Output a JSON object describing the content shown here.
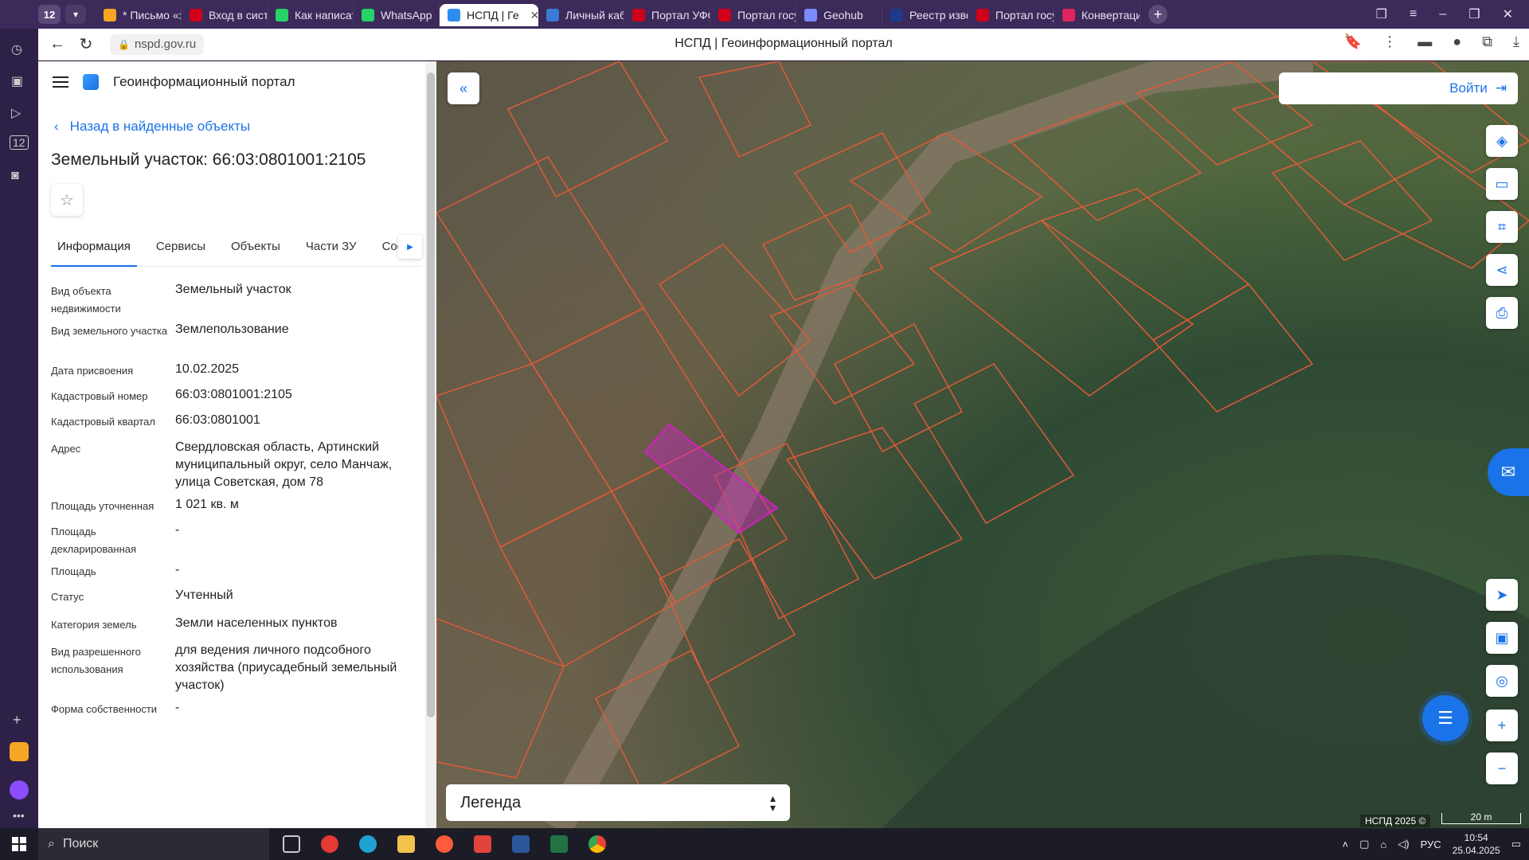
{
  "browser": {
    "tab_count": "12",
    "tabs": [
      {
        "label": "* Письмо «за",
        "color": "#f5a623"
      },
      {
        "label": "Вход в систе",
        "color": "#d0021b"
      },
      {
        "label": "Как написать",
        "color": "#25d366"
      },
      {
        "label": "WhatsApp",
        "color": "#25d366"
      },
      {
        "label": "НСПД | Ге",
        "color": "#2d8cf0"
      },
      {
        "label": "Личный каби",
        "color": "#3a7bd5"
      },
      {
        "label": "Портал УФО",
        "color": "#d0021b"
      },
      {
        "label": "Портал госу",
        "color": "#d0021b"
      },
      {
        "label": "Geohub",
        "color": "#7b8cff"
      },
      {
        "label": "Реестр извец",
        "color": "#1e3a8a"
      },
      {
        "label": "Портал госу",
        "color": "#d0021b"
      },
      {
        "label": "Конвертация",
        "color": "#e0245e"
      }
    ],
    "url": "nspd.gov.ru",
    "page_title": "НСПД | Геоинформационный портал"
  },
  "panel": {
    "portal_name": "Геоинформационный портал",
    "back_label": "Назад в найденные объекты",
    "title": "Земельный участок: 66:03:0801001:2105",
    "tabs": [
      "Информация",
      "Сервисы",
      "Объекты",
      "Части ЗУ",
      "Соста"
    ],
    "fields": [
      {
        "label": "Вид объекта недвижимости",
        "value": "Земельный участок"
      },
      {
        "label": "Вид земельного участка",
        "value": "Землепользование"
      },
      {
        "label": "Дата присвоения",
        "value": "10.02.2025"
      },
      {
        "label": "Кадастровый номер",
        "value": "66:03:0801001:2105"
      },
      {
        "label": "Кадастровый квартал",
        "value": "66:03:0801001"
      },
      {
        "label": "Адрес",
        "value": "Свердловская область, Артинский муниципальный округ, село Манчаж, улица Советская, дом 78"
      },
      {
        "label": "Площадь уточненная",
        "value": "1 021 кв. м"
      },
      {
        "label": "Площадь декларированная",
        "value": "-"
      },
      {
        "label": "Площадь",
        "value": "-"
      },
      {
        "label": "Статус",
        "value": "Учтенный"
      },
      {
        "label": "Категория земель",
        "value": "Земли населенных пунктов"
      },
      {
        "label": "Вид разрешенного использования",
        "value": "для ведения личного подсобного хозяйства (приусадебный земельный участок)"
      },
      {
        "label": "Форма собственности",
        "value": "-"
      }
    ]
  },
  "map": {
    "login_label": "Войти",
    "legend_label": "Легенда",
    "copyright": "НСПД 2025 ©",
    "scale_label": "20 m"
  },
  "taskbar": {
    "search_placeholder": "Поиск",
    "lang": "РУС",
    "time": "10:54",
    "date": "25.04.2025"
  }
}
